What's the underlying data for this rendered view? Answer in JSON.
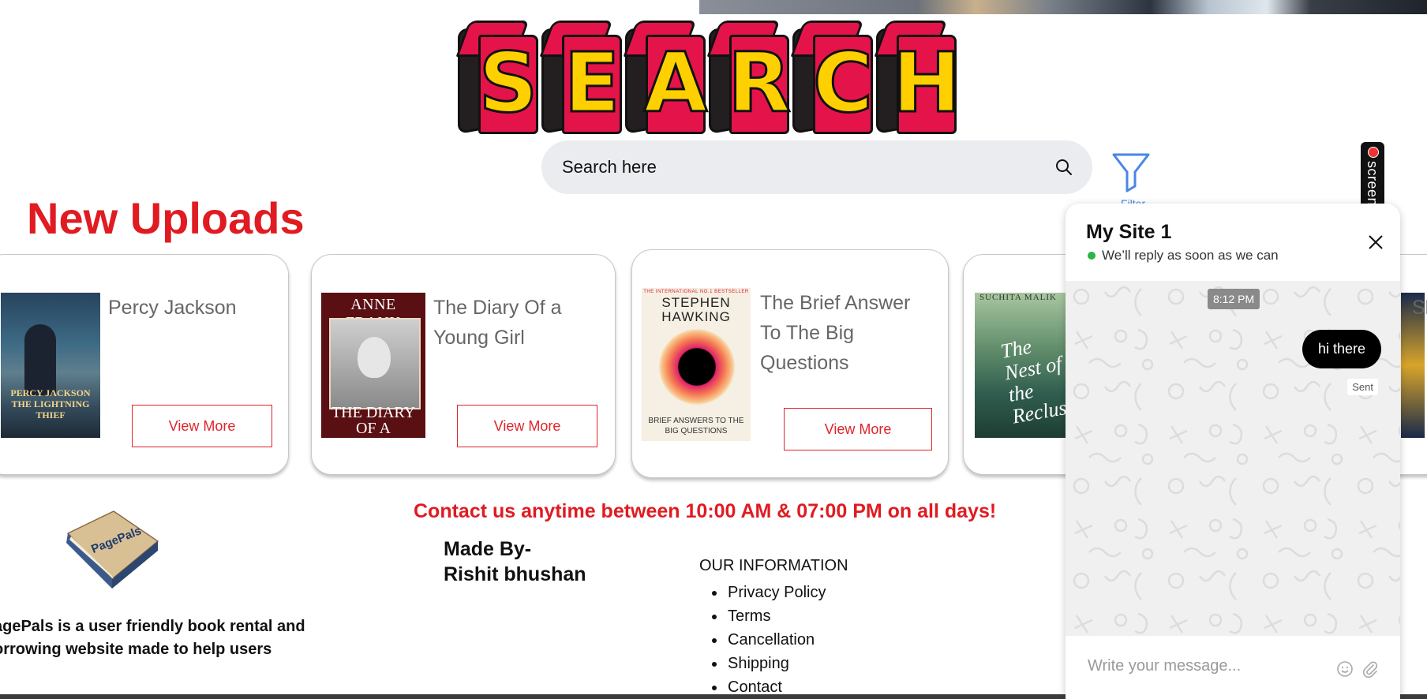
{
  "header": {
    "title_letters": [
      "S",
      "E",
      "A",
      "R",
      "C",
      "H"
    ]
  },
  "search": {
    "placeholder": "Search here",
    "filter_label": "Filter"
  },
  "screenrec": {
    "label": "screenrec"
  },
  "uploads": {
    "heading": "New Uploads",
    "books": [
      {
        "title": "Percy Jackson",
        "button": "View More",
        "cover_text": "PERCY JACKSON THE LIGHTNING THIEF"
      },
      {
        "title": "The Diary Of a Young Girl",
        "button": "View More",
        "cover_author": "ANNE FRANK",
        "cover_sub": "THE DIARY OF A"
      },
      {
        "title": "The Brief Answer To The Big Questions",
        "button": "View More",
        "cover_tag": "THE INTERNATIONAL NO.1 BESTSELLER",
        "cover_author": "STEPHEN HAWKING",
        "cover_sub": "BRIEF ANSWERS TO THE BIG QUESTIONS"
      },
      {
        "title": "",
        "cover_author": "SUCHITA MALIK",
        "cover_title": "The Nest of the Recluse"
      },
      {
        "title": "Sh"
      }
    ]
  },
  "footer": {
    "brand": "PagePals",
    "about": "agePals is a user friendly book rental and orrowing website made to help users",
    "contact": "Contact us anytime between 10:00 AM & 07:00 PM on all days!",
    "made_by_line1": "Made By-",
    "made_by_line2": "Rishit bhushan",
    "info_heading": "OUR INFORMATION",
    "links": [
      "Privacy Policy",
      "Terms",
      "Cancellation",
      "Shipping",
      "Contact"
    ]
  },
  "chat": {
    "site_name": "My Site 1",
    "status": "We’ll reply as soon as we can",
    "timestamp": "8:12 PM",
    "message": "hi there",
    "message_status": "Sent",
    "input_placeholder": "Write your message..."
  },
  "colors": {
    "accent_red": "#e01b22",
    "title_yellow": "#ffd000",
    "title_pink": "#e4144a",
    "online_green": "#2fb344",
    "filter_blue": "#4a86e8"
  }
}
